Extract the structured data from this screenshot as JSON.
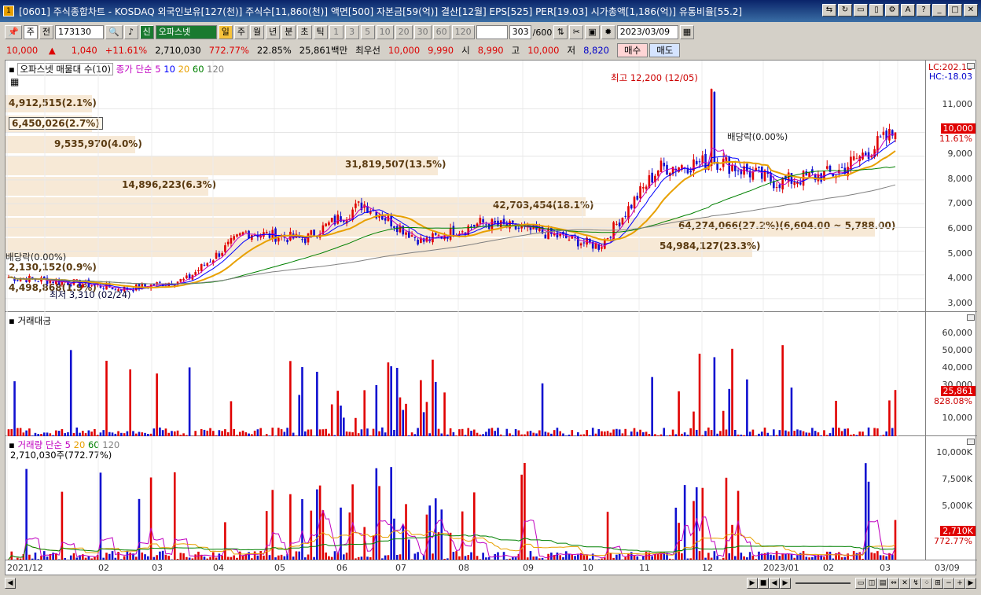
{
  "window": {
    "icon_label": "1",
    "title": "[0601] 주식종합차트 - KOSDAQ 외국인보유[127(천)] 주식수[11,860(천)] 액면[500] 자본금[59(억)] 결산[12월] EPS[525] PER[19.03] 시가총액[1,186(억)] 유통비율[55.2]"
  },
  "toolbar": {
    "market_type": "주",
    "prev_label": "전",
    "code": "173130",
    "badge": "신",
    "name": "오파스넷",
    "periods": [
      "일",
      "주",
      "월",
      "년",
      "분",
      "초",
      "틱"
    ],
    "active_period": "일",
    "intervals": [
      "1",
      "3",
      "5",
      "10",
      "20",
      "30",
      "60",
      "120"
    ],
    "count": "303",
    "count_max": "/600",
    "date": "2023/03/09"
  },
  "quote": {
    "price": "10,000",
    "arrow": "▲",
    "change": "1,040",
    "change_pct": "+11.61%",
    "volume": "2,710,030",
    "volume_ratio": "772.77%",
    "turnover_rate": "22.85%",
    "amount": "25,861백만",
    "best_bid_label": "최우선",
    "bid1": "10,000",
    "bid2": "9,990",
    "open_label": "시",
    "open": "8,990",
    "high_label": "고",
    "high": "10,000",
    "low_label": "저",
    "low": "8,820",
    "buy_label": "매수",
    "sell_label": "매도"
  },
  "price_pane": {
    "title": "오파스넷 매물대 수(10)",
    "ma_label": "종가 단순 5",
    "ma_periods": [
      "10",
      "20",
      "60",
      "120"
    ],
    "lc": "LC:202.11",
    "hc": "HC:-18.03",
    "high_note": "최고 12,200 (12/05)",
    "low_note": "최저 3,310 (02/24)",
    "dividend_1": "배당락(0.00%)",
    "dividend_2": "배당락(0.00%)",
    "current_tag": "10,000",
    "current_tag_pct": "11.61%",
    "y_ticks": [
      "11,000",
      "10,000",
      "9,000",
      "8,000",
      "7,000",
      "6,000",
      "5,000",
      "4,000",
      "3,000"
    ],
    "volume_profile": [
      {
        "label": "4,912,515(2.1%)",
        "bar_fraction": 0.021
      },
      {
        "label": "6,450,026(2.7%)",
        "bar_fraction": 0.027
      },
      {
        "label": "9,535,970(4.0%)",
        "bar_fraction": 0.04
      },
      {
        "label": "31,819,507(13.5%)",
        "bar_fraction": 0.135
      },
      {
        "label": "14,896,223(6.3%)",
        "bar_fraction": 0.063
      },
      {
        "label": "42,703,454(18.1%)",
        "bar_fraction": 0.181
      },
      {
        "label": "64,274,066(27.2%)(6,604.00 ~ 5,788.00)",
        "bar_fraction": 0.272
      },
      {
        "label": "54,984,127(23.3%)",
        "bar_fraction": 0.233
      },
      {
        "label": "2,130,152(0.9%)",
        "bar_fraction": 0.009
      },
      {
        "label": "4,498,868(1.9%)",
        "bar_fraction": 0.019
      }
    ]
  },
  "amount_pane": {
    "title": "거래대금",
    "y_ticks": [
      "60,000",
      "50,000",
      "40,000",
      "30,000",
      "10,000"
    ],
    "current_tag": "25,861",
    "current_tag_pct": "828.08%"
  },
  "volume_pane": {
    "title": "거래량",
    "ma_label": "단순 5",
    "ma_periods": [
      "20",
      "60",
      "120"
    ],
    "current_note": "2,710,030주(772.77%)",
    "y_ticks": [
      "10,000K",
      "7,500K",
      "5,000K"
    ],
    "current_tag": "2,710K",
    "current_tag_pct": "772.77%"
  },
  "x_axis": [
    "2021/12",
    "02",
    "03",
    "04",
    "05",
    "06",
    "07",
    "08",
    "09",
    "10",
    "11",
    "12",
    "2023/01",
    "02",
    "03",
    "03/09"
  ],
  "colors": {
    "up": "#e00000",
    "down": "#1010d0",
    "ma5": "#c000c0",
    "ma10": "#0000ff",
    "ma20": "#e8a000",
    "ma60": "#008000",
    "ma120": "#808080"
  },
  "chart_data": {
    "type": "candlestick",
    "title": "오파스넷",
    "date_range": [
      "2021/12",
      "2023/03/09"
    ],
    "price_high": 12200,
    "price_high_date": "12/05",
    "price_low": 3310,
    "price_low_date": "02/24",
    "current_price": 10000,
    "monthly_close_approx": [
      {
        "month": "2021/12",
        "close": 3900
      },
      {
        "month": "2022/01",
        "close": 3700
      },
      {
        "month": "2022/02",
        "close": 3400
      },
      {
        "month": "2022/03",
        "close": 3800
      },
      {
        "month": "2022/04",
        "close": 5800
      },
      {
        "month": "2022/05",
        "close": 5500
      },
      {
        "month": "2022/06",
        "close": 7000
      },
      {
        "month": "2022/07",
        "close": 5400
      },
      {
        "month": "2022/08",
        "close": 6200
      },
      {
        "month": "2022/09",
        "close": 5800
      },
      {
        "month": "2022/10",
        "close": 5200
      },
      {
        "month": "2022/11",
        "close": 8500
      },
      {
        "month": "2022/12",
        "close": 8800
      },
      {
        "month": "2023/01",
        "close": 7900
      },
      {
        "month": "2023/02",
        "close": 8300
      },
      {
        "month": "2023/03",
        "close": 10000
      }
    ]
  }
}
